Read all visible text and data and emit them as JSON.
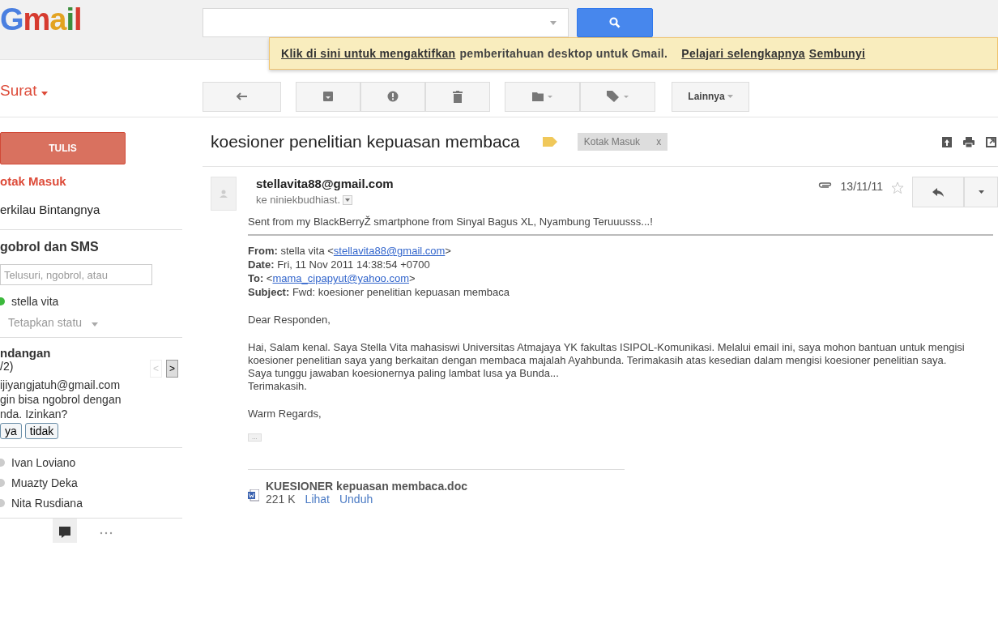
{
  "logo": {
    "text": "Gmail"
  },
  "notice": {
    "link": "Klik di sini untuk mengaktifkan",
    "text": "pemberitahuan desktop untuk Gmail.",
    "learn_more": "Pelajari selengkapnya",
    "hide": "Sembunyi"
  },
  "toolbar": {
    "more": "Lainnya"
  },
  "sidebar": {
    "mail_menu": "Surat",
    "compose": "TULIS",
    "items": [
      {
        "label": "otak Masuk",
        "selected": true
      },
      {
        "label": "erkilau Bintangnya",
        "selected": false
      }
    ]
  },
  "chat": {
    "title": "gobrol dan SMS",
    "placeholder": "Telusuri, ngobrol, atau",
    "me": {
      "name": "stella vita",
      "online": true
    },
    "status": "Tetapkan statu",
    "invite": {
      "title": "ndangan",
      "counter": "/2)",
      "prev": "<",
      "next": ">",
      "prev_disabled": true,
      "email": "ijiyangjatuh@gmail.com",
      "lines": [
        "gin bisa ngobrol dengan",
        "nda. Izinkan?"
      ],
      "buttons": [
        "ya",
        "tidak"
      ]
    },
    "contacts": [
      {
        "name": "Ivan Loviano",
        "online": false
      },
      {
        "name": "Muazty Deka",
        "online": false
      },
      {
        "name": "Nita Rusdiana",
        "online": false
      }
    ]
  },
  "thread": {
    "subject": "koesioner penelitian kepuasan membaca",
    "label": "Kotak Masuk",
    "label_close": "x"
  },
  "message": {
    "sender": "stellavita88@gmail.com",
    "to": "ke niniekbudhiast.",
    "date": "13/11/11",
    "starred": false,
    "has_attachment": true,
    "first_line": "Sent from my BlackBerryŽ smartphone from Sinyal Bagus XL, Nyambung Teruuusss...!",
    "headers": [
      {
        "text": "**From:** stella vita <",
        "link": "stellavita88@gmail.com",
        "after": ">"
      },
      {
        "text": "**Date:** Fri, 11 Nov 2011 14:38:54 +0700"
      },
      {
        "text": "**To:** <",
        "link": "mama_cipapyut@yahoo.com",
        "after": ">"
      },
      {
        "text": "**Subject:** Fwd: koesioner penelitian kepuasan membaca"
      }
    ],
    "paragraphs": [
      [
        "Dear Responden,"
      ],
      [
        "Hai, Salam kenal. Saya Stella Vita mahasiswi Universitas Atmajaya YK fakultas ISIPOL-Komunikasi. Melalui email ini, saya mohon bantuan untuk mengisi koesioner penelitian saya yang berkaitan dengan membaca majalah Ayahbunda. Terimakasih atas kesedian dalam mengisi koesioner penelitian saya.",
        "Saya tunggu jawaban koesionernya paling lambat lusa ya Bunda...",
        "Terimakasih."
      ],
      [
        "Warm Regards,"
      ]
    ],
    "quoted": "...",
    "attachment": {
      "name": "KUESIONER kepuasan membaca.doc",
      "size": "221 K",
      "actions": [
        "Lihat",
        "Unduh"
      ]
    }
  }
}
